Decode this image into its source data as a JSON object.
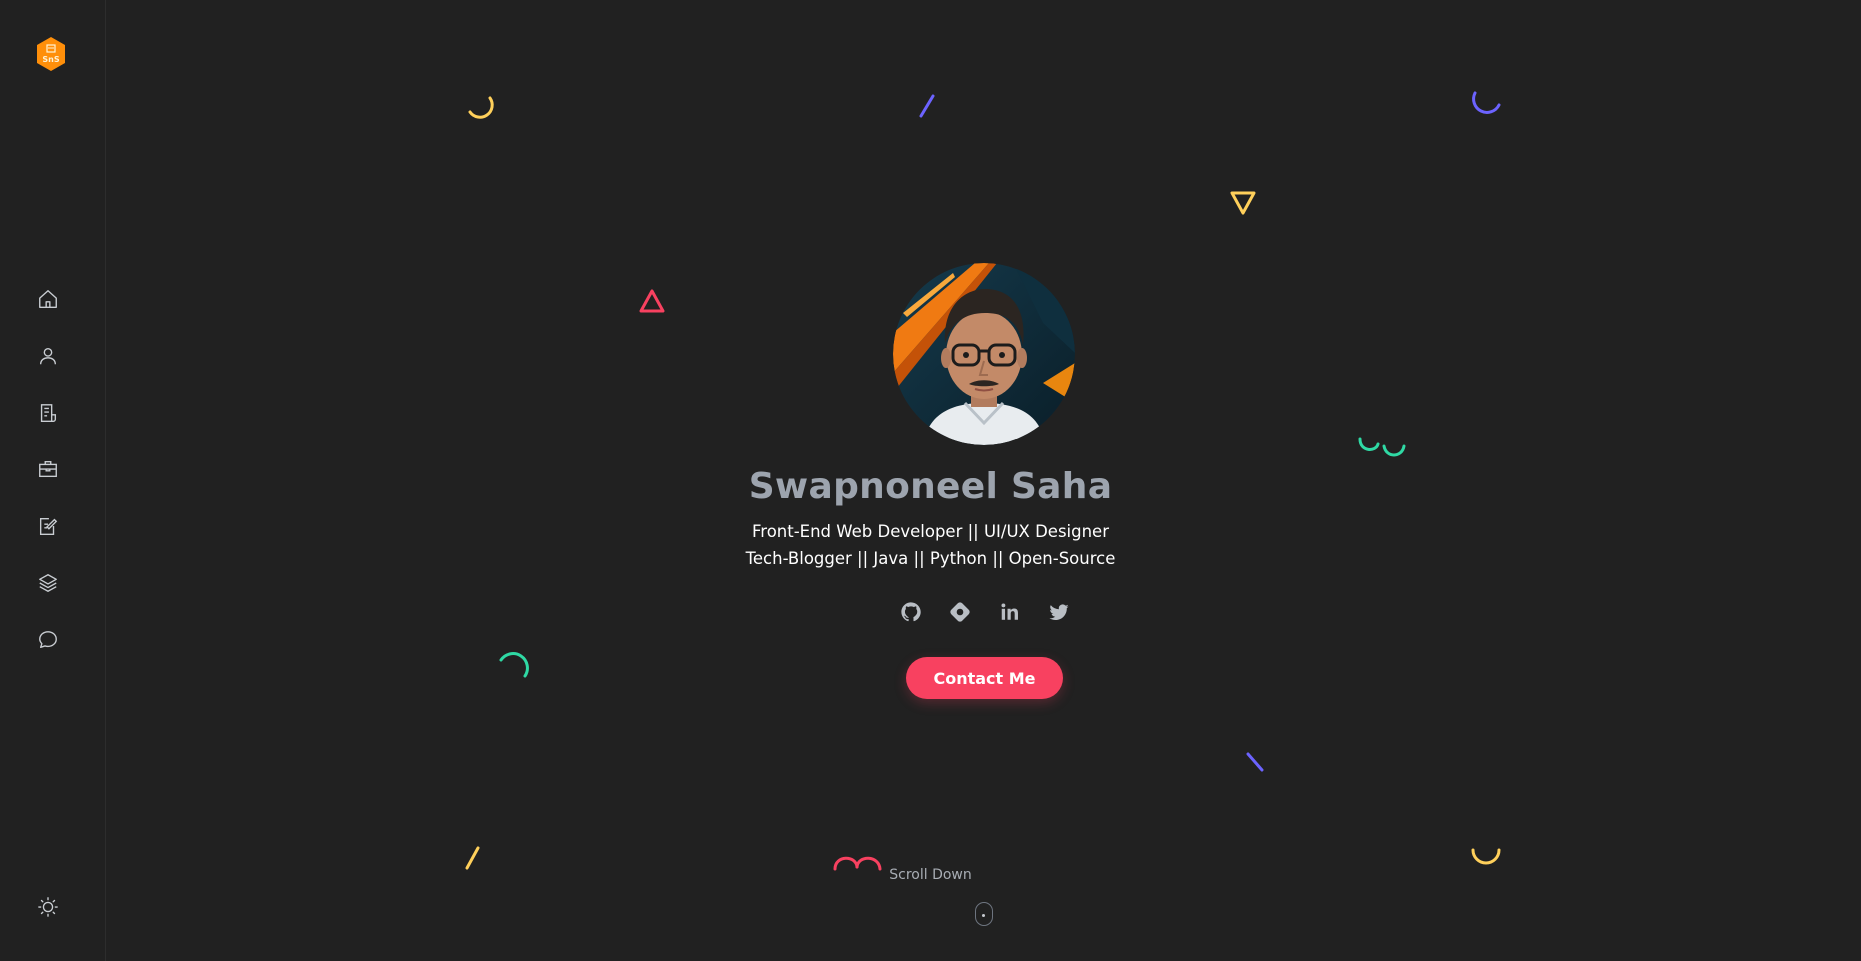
{
  "logo": {
    "text": "SnS",
    "color": "#ff8f0a"
  },
  "sidebar": {
    "items": [
      {
        "icon": "home-icon",
        "label": "Home"
      },
      {
        "icon": "user-icon",
        "label": "About"
      },
      {
        "icon": "document-icon",
        "label": "Resume"
      },
      {
        "icon": "briefcase-icon",
        "label": "Work"
      },
      {
        "icon": "edit-icon",
        "label": "Blog"
      },
      {
        "icon": "layers-icon",
        "label": "Services"
      },
      {
        "icon": "chat-icon",
        "label": "Contact"
      }
    ],
    "theme_toggle_icon": "sun-icon"
  },
  "hero": {
    "name": "Swapnoneel Saha",
    "subtitle_line1": "Front-End Web Developer || UI/UX Designer",
    "subtitle_line2": "Tech-Blogger || Java || Python || Open-Source",
    "social": [
      "github-icon",
      "hashnode-icon",
      "linkedin-icon",
      "twitter-icon"
    ],
    "contact_label": "Contact Me",
    "scroll_label": "Scroll Down"
  },
  "colors": {
    "background": "#212121",
    "accent": "#f84160",
    "name": "#9da4ae",
    "yellow": "#ffd05b",
    "purple": "#6c63ff",
    "green": "#2fd9a4"
  }
}
